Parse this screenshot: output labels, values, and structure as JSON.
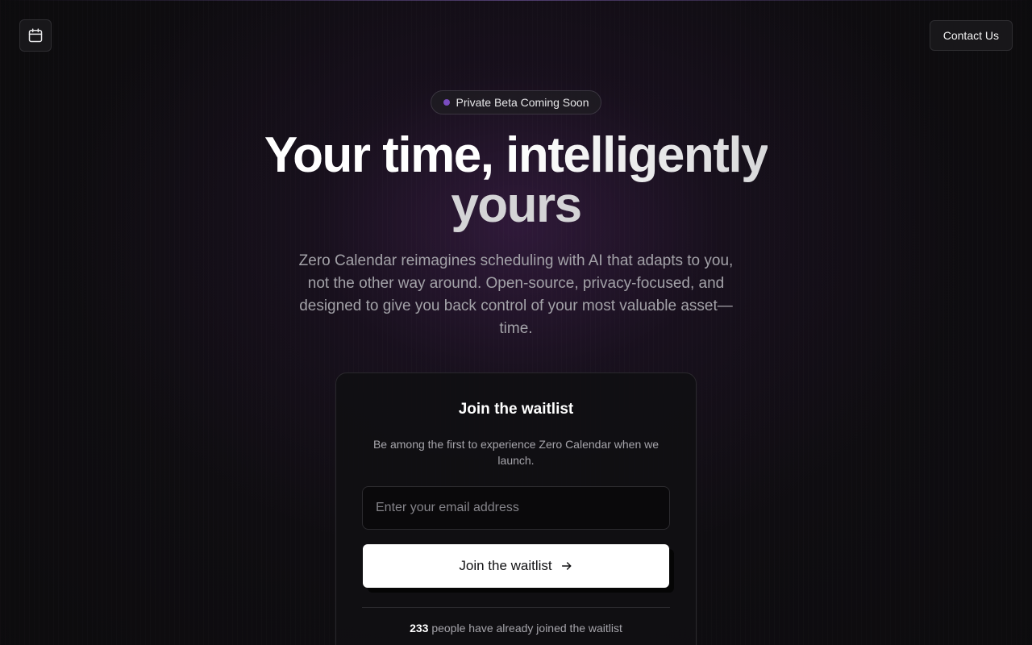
{
  "header": {
    "logo_icon": "calendar-icon",
    "contact_label": "Contact Us"
  },
  "hero": {
    "badge": "Private Beta Coming Soon",
    "title_part1": "Your time,",
    "title_part2": "intelligently",
    "title_line2": "yours",
    "description": "Zero Calendar reimagines scheduling with AI that adapts to you, not the other way around. Open-source, privacy-focused, and designed to give you back control of your most valuable asset—time."
  },
  "waitlist": {
    "title": "Join the waitlist",
    "subtitle": "Be among the first to experience Zero Calendar when we launch.",
    "email_placeholder": "Enter your email address",
    "button_label": "Join the waitlist",
    "button_icon": "arrow-right-icon",
    "count": "233",
    "count_suffix": "people have already joined the waitlist"
  },
  "colors": {
    "background": "#0c0b0d",
    "accent_glow": "#482258",
    "badge_dot": "#7a4cc0",
    "button_bg": "#ffffff"
  }
}
